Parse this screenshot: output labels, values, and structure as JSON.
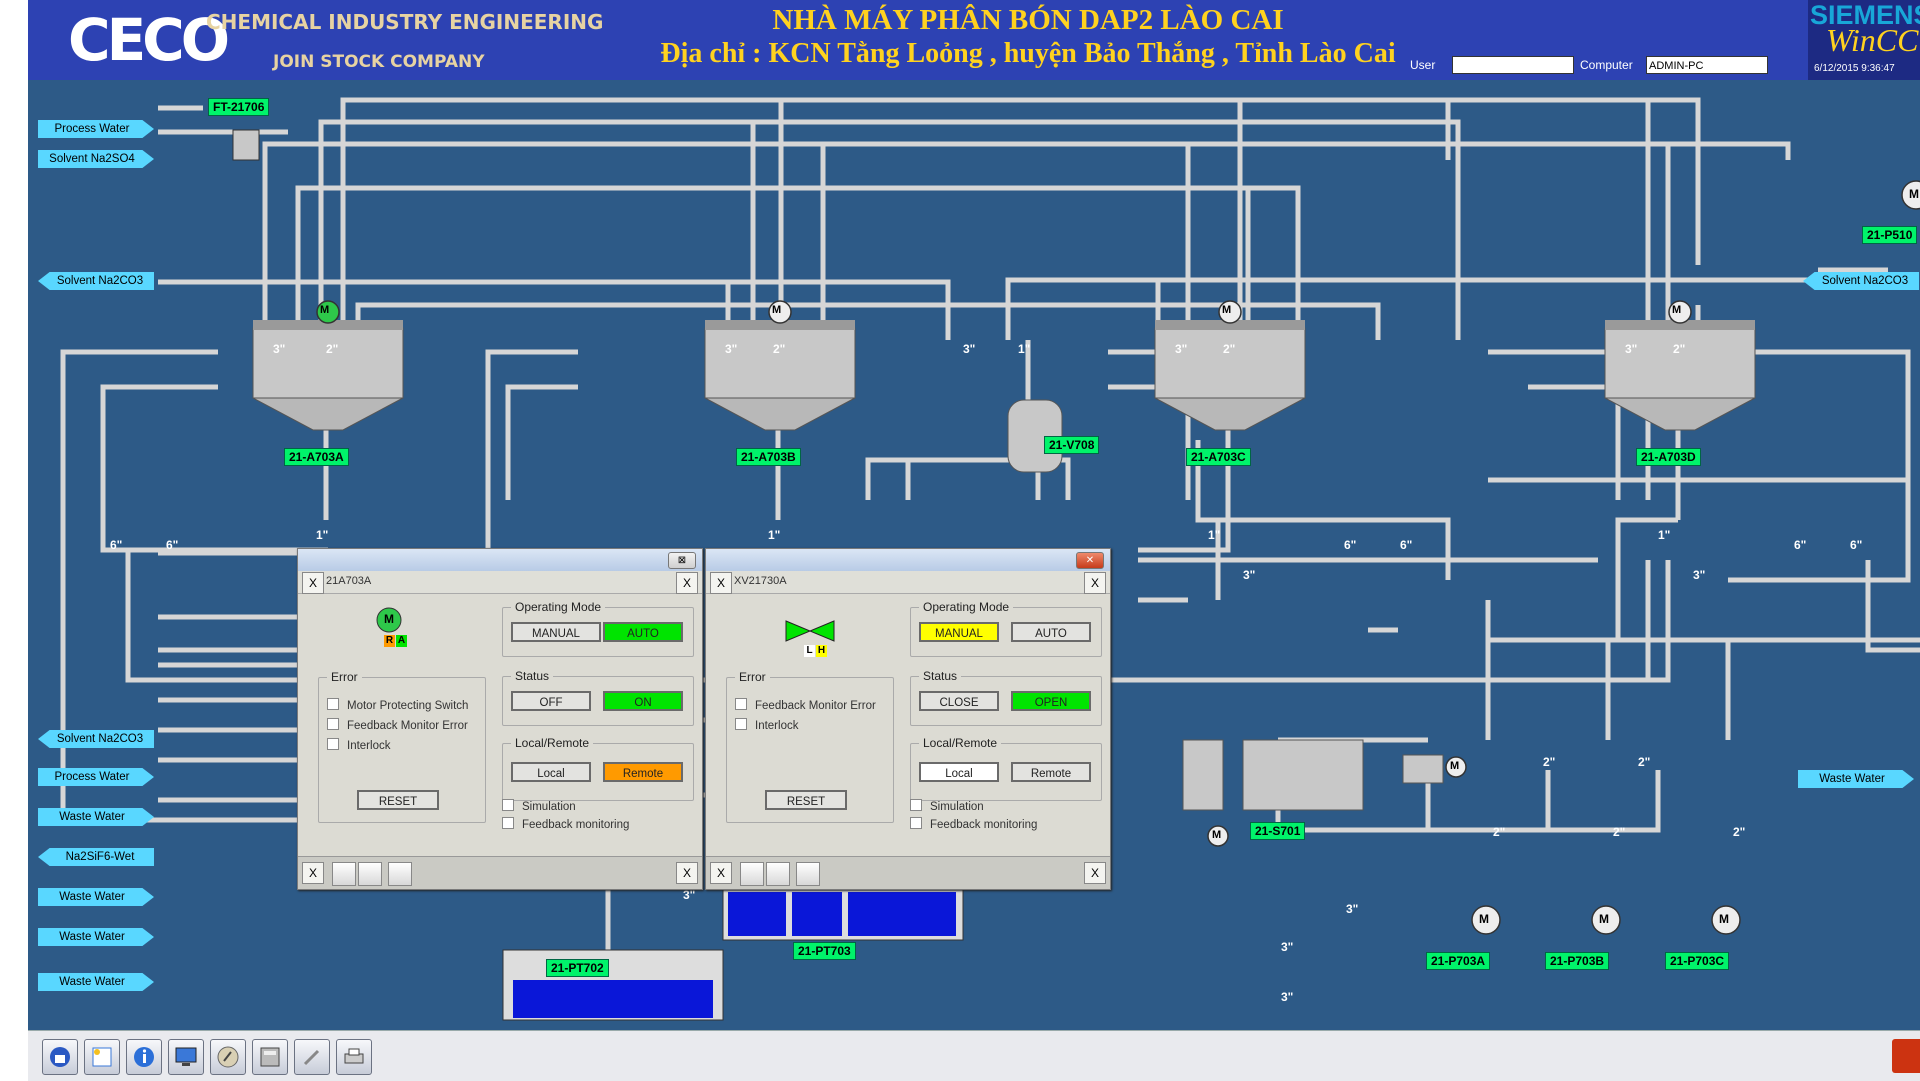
{
  "header": {
    "brand": "CECO",
    "company_line1": "CHEMICAL INDUSTRY ENGINEERING",
    "company_line2": "JOIN STOCK COMPANY",
    "title_line1": "NHÀ MÁY PHÂN BÓN DAP2 LÀO CAI",
    "title_line2": "Địa chỉ : KCN Tằng Loỏng , huyện Bảo Thắng , Tỉnh Lào Cai",
    "user_label": "User",
    "user_value": "",
    "computer_label": "Computer",
    "computer_value": "ADMIN-PC",
    "siemens": "SIEMENS",
    "wincc": "WinCC",
    "datetime": "6/12/2015 9:36:47"
  },
  "streams_left": [
    {
      "label": "Process Water",
      "dir": "right"
    },
    {
      "label": "Solvent Na2SO4",
      "dir": "right"
    },
    {
      "label": "Solvent Na2CO3",
      "dir": "left"
    },
    {
      "label": "Solvent Na2CO3",
      "dir": "left"
    },
    {
      "label": "Process Water",
      "dir": "right"
    },
    {
      "label": "Waste Water",
      "dir": "right"
    },
    {
      "label": "Na2SiF6-Wet",
      "dir": "left"
    },
    {
      "label": "Waste Water",
      "dir": "right"
    },
    {
      "label": "Waste Water",
      "dir": "right"
    },
    {
      "label": "Waste Water",
      "dir": "right"
    }
  ],
  "streams_right": [
    {
      "label": "Solvent Na2CO3",
      "dir": "left"
    },
    {
      "label": "Waste Water",
      "dir": "right"
    }
  ],
  "tags": {
    "ft": "FT-21706",
    "p510": "21-P510",
    "v708": "21-V708",
    "s701": "21-S701",
    "pt702": "21-PT702",
    "pt703": "21-PT703",
    "p703a": "21-P703A",
    "p703b": "21-P703B",
    "p703c": "21-P703C"
  },
  "tanks": [
    {
      "tag": "21-A703A"
    },
    {
      "tag": "21-A703B"
    },
    {
      "tag": "21-A703C"
    },
    {
      "tag": "21-A703D"
    }
  ],
  "pipe_sizes": {
    "s3": "3\"",
    "s2": "2\"",
    "s1": "1\"",
    "s6": "6\""
  },
  "indicators": {
    "r": "R",
    "a": "A",
    "l": "L",
    "h": "H",
    "m": "M"
  },
  "dialog_motor": {
    "title": "21A703A",
    "operating_mode": "Operating Mode",
    "manual": "MANUAL",
    "auto": "AUTO",
    "error": "Error",
    "err1": "Motor Protecting Switch",
    "err2": "Feedback Monitor Error",
    "err3": "Interlock",
    "status": "Status",
    "off": "OFF",
    "on": "ON",
    "local_remote": "Local/Remote",
    "local": "Local",
    "remote": "Remote",
    "reset": "RESET",
    "simulation": "Simulation",
    "feedback": "Feedback monitoring",
    "x": "X"
  },
  "dialog_valve": {
    "title": "XV21730A",
    "operating_mode": "Operating Mode",
    "manual": "MANUAL",
    "auto": "AUTO",
    "error": "Error",
    "err1": "Feedback Monitor Error",
    "err2": "Interlock",
    "status": "Status",
    "close": "CLOSE",
    "open": "OPEN",
    "local_remote": "Local/Remote",
    "local": "Local",
    "remote": "Remote",
    "reset": "RESET",
    "simulation": "Simulation",
    "feedback": "Feedback monitoring",
    "x": "X"
  },
  "colors": {
    "background": "#2d5a87",
    "pipe": "#d9d9d9",
    "tag_green": "#00f36a",
    "stream_cyan": "#59d7ff",
    "btn_green": "#00e400",
    "btn_yellow": "#ffff00",
    "btn_orange": "#ff9a00",
    "tank_liquid": "#0a17d8"
  }
}
